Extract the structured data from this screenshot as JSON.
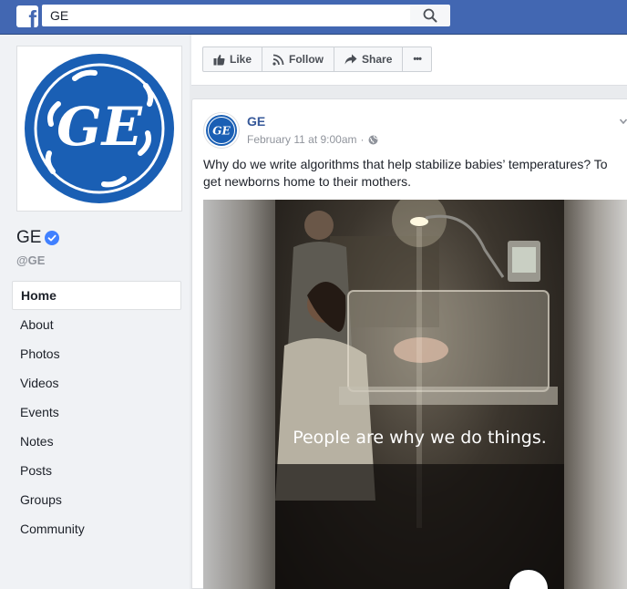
{
  "topbar": {
    "logo_letter": "f",
    "search_value": "GE",
    "search_icon": "search-icon"
  },
  "page": {
    "name": "GE",
    "handle": "@GE",
    "verified_icon": "verified-check-icon",
    "logo_letters": "GE"
  },
  "nav": {
    "items": [
      "Home",
      "About",
      "Photos",
      "Videos",
      "Events",
      "Notes",
      "Posts",
      "Groups",
      "Community"
    ],
    "active": "Home"
  },
  "actions": {
    "like": "Like",
    "follow": "Follow",
    "share": "Share",
    "more": "•••"
  },
  "post": {
    "author": "GE",
    "timestamp": "February 11 at 9:00am",
    "separator": "·",
    "privacy_icon": "globe-icon",
    "text": "Why do we write algorithms that help stabilize babies’ temperatures? To get newborns home to their mothers.",
    "video_caption": "People are why we do things."
  },
  "colors": {
    "brand_blue": "#4267b2",
    "ge_blue": "#1a5fb4",
    "link": "#365899"
  }
}
